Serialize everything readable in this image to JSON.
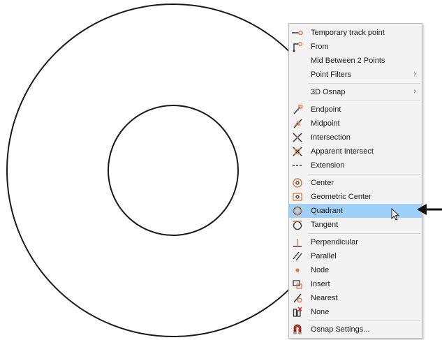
{
  "menu": {
    "groups": [
      {
        "items": [
          {
            "label": "Temporary track point",
            "icon": "temporary-track-point-icon"
          },
          {
            "label": "From",
            "icon": "from-icon"
          },
          {
            "label": "Mid Between 2 Points",
            "icon": "none"
          },
          {
            "label": "Point Filters",
            "icon": "none",
            "submenu": "›"
          }
        ]
      },
      {
        "items": [
          {
            "label": "3D Osnap",
            "icon": "none",
            "submenu": "›"
          }
        ]
      },
      {
        "items": [
          {
            "label": "Endpoint",
            "icon": "endpoint-icon"
          },
          {
            "label": "Midpoint",
            "icon": "midpoint-icon"
          },
          {
            "label": "Intersection",
            "icon": "intersection-icon"
          },
          {
            "label": "Apparent Intersect",
            "icon": "apparent-intersect-icon"
          },
          {
            "label": "Extension",
            "icon": "extension-icon"
          }
        ]
      },
      {
        "items": [
          {
            "label": "Center",
            "icon": "center-icon"
          },
          {
            "label": "Geometric Center",
            "icon": "geometric-center-icon"
          },
          {
            "label": "Quadrant",
            "icon": "quadrant-icon",
            "highlighted": true
          },
          {
            "label": "Tangent",
            "icon": "tangent-icon"
          }
        ]
      },
      {
        "items": [
          {
            "label": "Perpendicular",
            "icon": "perpendicular-icon"
          },
          {
            "label": "Parallel",
            "icon": "parallel-icon"
          },
          {
            "label": "Node",
            "icon": "node-icon"
          },
          {
            "label": "Insert",
            "icon": "insert-icon"
          },
          {
            "label": "Nearest",
            "icon": "nearest-icon"
          },
          {
            "label": "None",
            "icon": "none-snap-icon"
          }
        ]
      },
      {
        "items": [
          {
            "label": "Osnap Settings...",
            "icon": "osnap-settings-icon"
          }
        ]
      }
    ]
  },
  "colors": {
    "highlight": "#9fd0f7",
    "snap_orange": "#e07a3c",
    "menu_bg": "#f3f3f3",
    "stroke": "#1a1a1a"
  }
}
